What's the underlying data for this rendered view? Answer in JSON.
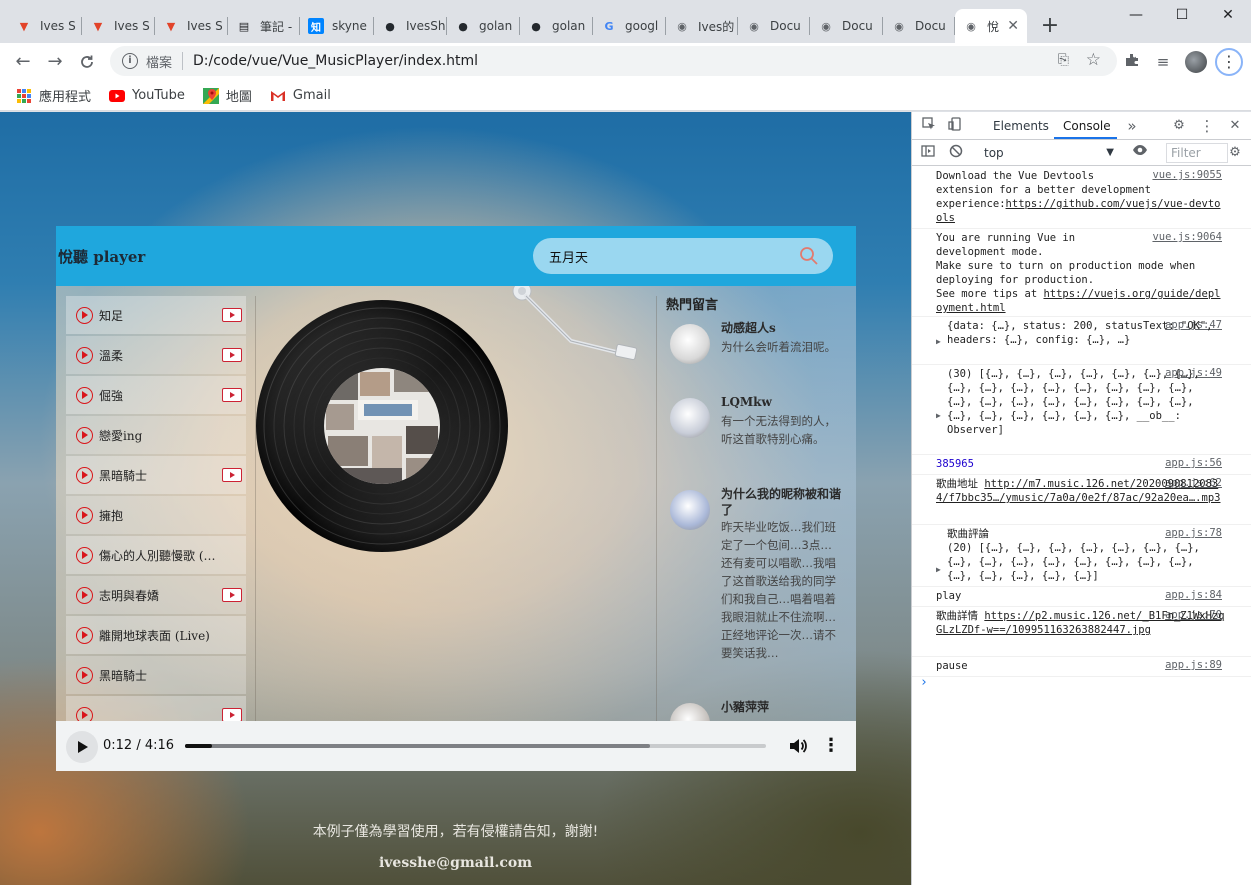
{
  "browser": {
    "tabs": [
      {
        "label": "Ives S",
        "favicon": "gitlab-icon",
        "color": "#e24329"
      },
      {
        "label": "Ives S",
        "favicon": "gitlab-icon",
        "color": "#e24329"
      },
      {
        "label": "Ives S",
        "favicon": "gitlab-icon",
        "color": "#e24329"
      },
      {
        "label": "筆記 -",
        "favicon": "document-icon",
        "color": "#202124"
      },
      {
        "label": "skyne",
        "favicon": "zhihu-icon",
        "color": "#0084ff"
      },
      {
        "label": "IvesSh",
        "favicon": "github-icon",
        "color": "#24292e"
      },
      {
        "label": "golan",
        "favicon": "github-icon",
        "color": "#24292e"
      },
      {
        "label": "golan",
        "favicon": "github-icon",
        "color": "#24292e"
      },
      {
        "label": "googl",
        "favicon": "google-icon",
        "color": "#4285f4"
      },
      {
        "label": "Ives的",
        "favicon": "globe-icon",
        "color": "#5f6368"
      },
      {
        "label": "Docu",
        "favicon": "globe-icon",
        "color": "#5f6368"
      },
      {
        "label": "Docu",
        "favicon": "globe-icon",
        "color": "#5f6368"
      },
      {
        "label": "Docu",
        "favicon": "globe-icon",
        "color": "#5f6368"
      },
      {
        "label": "悅",
        "favicon": "globe-icon",
        "color": "#5f6368",
        "active": true
      }
    ],
    "window_controls": {
      "minimize": "—",
      "maximize": "☐",
      "close": "✕"
    },
    "address": {
      "scheme_label": "檔案",
      "url": "D:/code/vue/Vue_MusicPlayer/index.html"
    },
    "bookmarks": [
      {
        "label": "應用程式",
        "icon": "apps-grid-icon"
      },
      {
        "label": "YouTube",
        "icon": "youtube-icon",
        "color": "#ff0000"
      },
      {
        "label": "地圖",
        "icon": "maps-icon"
      },
      {
        "label": "Gmail",
        "icon": "gmail-icon",
        "color": "#d93025"
      }
    ]
  },
  "player": {
    "logo": "悅聽 player",
    "search_value": "五月天",
    "songs": [
      {
        "name": "知足",
        "has_mv": true
      },
      {
        "name": "溫柔",
        "has_mv": true
      },
      {
        "name": "倔強",
        "has_mv": true
      },
      {
        "name": "戀愛ing",
        "has_mv": false
      },
      {
        "name": "黑暗騎士",
        "has_mv": true
      },
      {
        "name": "擁抱",
        "has_mv": false
      },
      {
        "name": "傷心的人別聽慢歌 (…",
        "has_mv": false
      },
      {
        "name": "志明與春嬌",
        "has_mv": true
      },
      {
        "name": "離開地球表面 (Live)",
        "has_mv": false
      },
      {
        "name": "黑暗騎士",
        "has_mv": false
      },
      {
        "name": "",
        "has_mv": true
      }
    ],
    "comments_title": "熱門留言",
    "comments": [
      {
        "nick": "动感超人s",
        "text": "为什么会听着流泪呢。",
        "avatar_color": "#d8d8d8"
      },
      {
        "nick": "LQMkw",
        "text": "有一个无法得到的人，听这首歌特别心痛。",
        "avatar_color": "#c8cdd8"
      },
      {
        "nick": "为什么我的昵称被和谐了",
        "text": "昨天毕业吃饭…我们班定了一个包间…3点…还有麦可以唱歌…我唱了这首歌送给我的同学们和我自己…唱着唱着我眼泪就止不住流啊…正经地评论一次…请不要笑话我…",
        "avatar_color": "#aab8d8"
      },
      {
        "nick": "小豬萍萍",
        "text": "",
        "avatar_color": "#c6c2be"
      }
    ],
    "audio": {
      "time_label": "0:12 / 4:16",
      "progress": 0.047,
      "buffered": 0.8
    }
  },
  "footer": {
    "disclaimer": "本例子僅為學習使用，若有侵權請告知，謝謝!",
    "email": "ivesshe@gmail.com"
  },
  "devtools": {
    "tabs": [
      "Elements",
      "Console"
    ],
    "active_tab": "Console",
    "context": "top",
    "filter_placeholder": "Filter",
    "messages": [
      {
        "text": "Download the Vue Devtools\nextension for a better development\nexperience:",
        "link": "https://github.com/vuejs/vue-devtools",
        "src": "vue.js:9055"
      },
      {
        "text": "You are running Vue in\ndevelopment mode.\nMake sure to turn on production mode when\ndeploying for production.\nSee more tips at ",
        "link": "https://vuejs.org/guide/deployment.html",
        "src": "vue.js:9064"
      },
      {
        "text": "{data: {…}, status: 200, statusText: \"OK\",\nheaders: {…}, config: {…}, …}",
        "src": "app.js:47"
      },
      {
        "text": "(30) [{…}, {…}, {…}, {…}, {…}, {…}, {…},\n{…}, {…}, {…}, {…}, {…}, {…}, {…}, {…},\n{…}, {…}, {…}, {…}, {…}, {…}, {…}, {…},\n{…}, {…}, {…}, {…}, {…}, {…}, __ob__:\nObserver]",
        "src": "app.js:49"
      },
      {
        "text": "385965",
        "src": "app.js:56"
      },
      {
        "text": "歌曲地址 ",
        "link": "http://m7.music.126.net/20200908120834/f7bbc35…/ymusic/7a0a/0e2f/87ac/92a20ea….mp3",
        "src": "app.js:62"
      },
      {
        "text": "歌曲評論\n(20) [{…}, {…}, {…}, {…}, {…}, {…}, {…},\n{…}, {…}, {…}, {…}, {…}, {…}, {…}, {…},\n{…}, {…}, {…}, {…}, {…}]",
        "src": "app.js:78"
      },
      {
        "text": "play",
        "src": "app.js:84"
      },
      {
        "text": "歌曲詳情 ",
        "link": "https://p2.music.126.net/_B1Fn_Z1WxHzqGLzLZDf-w==/109951163263882447.jpg",
        "src": "app.js:70"
      },
      {
        "text": "pause",
        "src": "app.js:89"
      }
    ]
  }
}
